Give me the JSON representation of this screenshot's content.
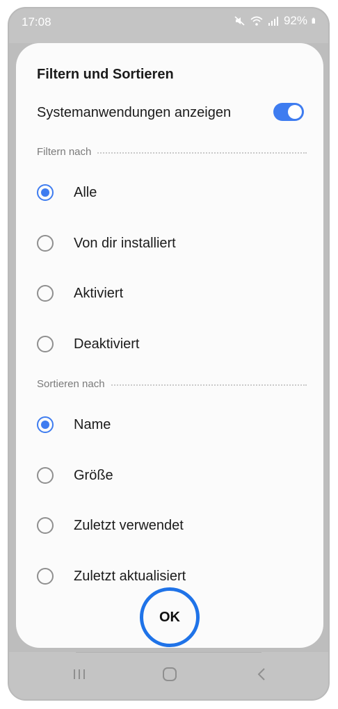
{
  "status_bar": {
    "time": "17:08",
    "battery": "92%",
    "icons": [
      "mute-icon",
      "wifi-icon",
      "signal-icon",
      "battery-icon"
    ]
  },
  "dialog": {
    "title": "Filtern und Sortieren",
    "toggle_label": "Systemanwendungen anzeigen",
    "toggle_on": true,
    "filter_header": "Filtern nach",
    "filter_options": [
      {
        "label": "Alle",
        "checked": true
      },
      {
        "label": "Von dir installiert",
        "checked": false
      },
      {
        "label": "Aktiviert",
        "checked": false
      },
      {
        "label": "Deaktiviert",
        "checked": false
      }
    ],
    "sort_header": "Sortieren nach",
    "sort_options": [
      {
        "label": "Name",
        "checked": true
      },
      {
        "label": "Größe",
        "checked": false
      },
      {
        "label": "Zuletzt verwendet",
        "checked": false
      },
      {
        "label": "Zuletzt aktualisiert",
        "checked": false
      }
    ],
    "ok_label": "OK"
  },
  "colors": {
    "accent": "#3e7cf0",
    "highlight_ring": "#1f73e8"
  },
  "nav_bar": {
    "icons": [
      "recents-icon",
      "home-icon",
      "back-icon"
    ]
  }
}
